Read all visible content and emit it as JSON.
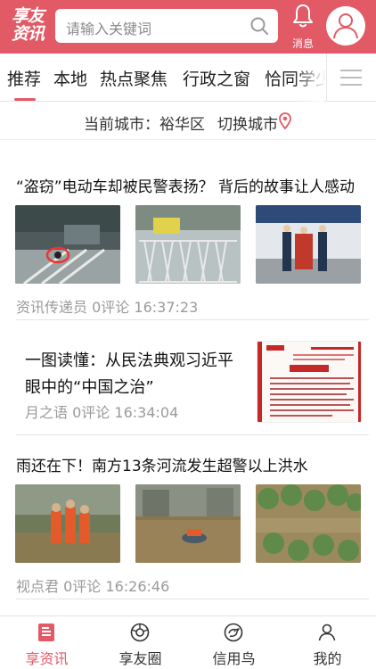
{
  "header": {
    "logo_line1": "享友",
    "logo_line2": "资讯",
    "search_placeholder": "请输入关键词",
    "bell_label": "消息",
    "search_icon": "search-icon",
    "bell_icon": "bell-icon",
    "avatar_icon": "user-avatar-icon"
  },
  "tabs": [
    {
      "label": "推荐",
      "active": true
    },
    {
      "label": "本地"
    },
    {
      "label": "热点聚焦"
    },
    {
      "label": "行政之窗"
    },
    {
      "label": "恰同学少"
    }
  ],
  "city": {
    "current": "当前城市：裕华区",
    "switch": "切换城市"
  },
  "news": [
    {
      "title": "“盗窃”电动车却被民警表扬？ 背后的故事让人感动",
      "source": "资讯传递员",
      "comments": "0评论",
      "time": "16:37:23"
    },
    {
      "title_line1": "一图读懂：从民法典观习近平",
      "title_line2": "眼中的“中国之治”",
      "source": "月之语",
      "comments": "0评论",
      "time": "16:34:04"
    },
    {
      "title": "雨还在下！南方13条河流发生超警以上洪水",
      "source": "视点君",
      "comments": "0评论",
      "time": "16:26:46"
    }
  ],
  "bottom_nav": [
    {
      "label": "享资讯",
      "icon": "news-icon",
      "active": true
    },
    {
      "label": "享友圈",
      "icon": "camera-icon"
    },
    {
      "label": "信用鸟",
      "icon": "bird-icon"
    },
    {
      "label": "我的",
      "icon": "person-icon"
    }
  ],
  "colors": {
    "brand": "#e15a66",
    "meta_text": "#9a9a9a"
  }
}
